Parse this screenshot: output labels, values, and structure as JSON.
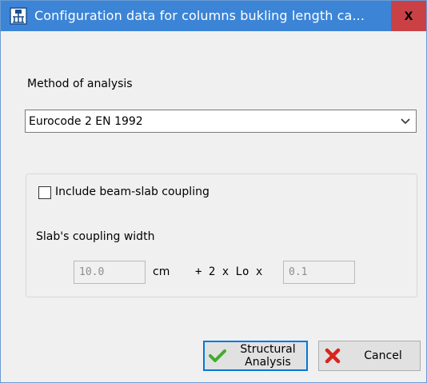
{
  "window": {
    "title": "Configuration data for columns bukling length ca...",
    "close_label": "x"
  },
  "method": {
    "label": "Method of analysis",
    "selected": "Eurocode 2 EN 1992"
  },
  "coupling": {
    "checkbox_label": "Include beam-slab coupling",
    "checked": false,
    "width_label": "Slab's coupling width",
    "width_value": "10.0",
    "width_unit": "cm",
    "formula_text": "+ 2 x Lo x",
    "factor_value": "0.1"
  },
  "buttons": {
    "structural_line1": "Structural",
    "structural_line2": "Analysis",
    "cancel": "Cancel"
  },
  "colors": {
    "titlebar": "#3c84d6",
    "close_button": "#c94145",
    "check_icon": "#3fae29",
    "cancel_icon": "#d9241c"
  }
}
